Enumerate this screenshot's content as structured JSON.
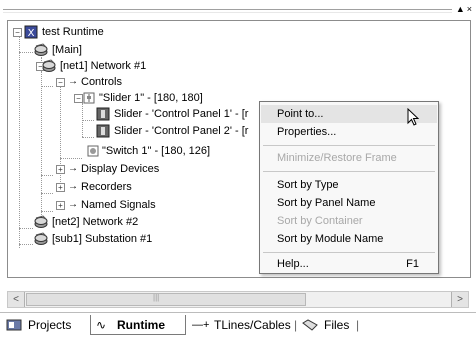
{
  "window": {
    "controls": "▲×"
  },
  "tree": {
    "root": "test Runtime",
    "main": "[Main]",
    "net1": "[net1] Network #1",
    "controls": "Controls",
    "slider1": "\"Slider 1\" - [180, 180]",
    "slider_cp1": "Slider - 'Control Panel 1' - [r",
    "slider_cp2": "Slider - 'Control Panel 2' - [r",
    "switch1": "\"Switch 1\" - [180, 126]",
    "display_devices": "Display Devices",
    "recorders": "Recorders",
    "named_signals": "Named Signals",
    "net2": "[net2] Network #2",
    "sub1": "[sub1] Substation #1"
  },
  "context_menu": {
    "point_to": "Point to...",
    "properties": "Properties...",
    "minimize_restore": "Minimize/Restore Frame",
    "sort_by_type": "Sort by Type",
    "sort_by_panel": "Sort by Panel Name",
    "sort_by_container": "Sort by Container",
    "sort_by_module": "Sort by Module Name",
    "help": "Help...",
    "help_shortcut": "F1"
  },
  "tabs": {
    "projects": "Projects",
    "runtime": "Runtime",
    "tlines": "TLines/Cables",
    "files": "Files"
  },
  "scrollbar": {
    "left": "<",
    "right": ">",
    "grip": "|||"
  }
}
